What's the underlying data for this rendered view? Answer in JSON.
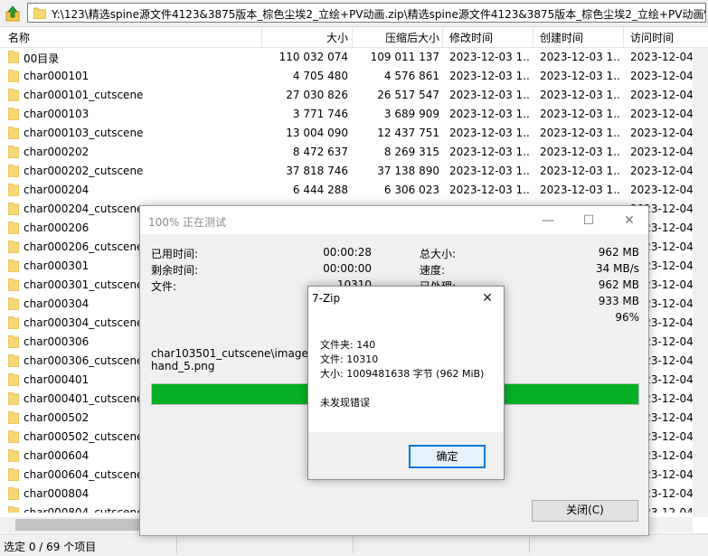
{
  "address_bar": {
    "path": "Y:\\123\\精选spine源文件4123&3875版本_棕色尘埃2_立绘+PV动画.zip\\精选spine源文件4123&3875版本_棕色尘埃2_立绘+PV动画\\"
  },
  "columns": {
    "name": "名称",
    "size": "大小",
    "packed": "压缩后大小",
    "modified": "修改时间",
    "created": "创建时间",
    "accessed": "访问时间"
  },
  "files": [
    {
      "name": "00目录",
      "size": "110 032 074",
      "packed": "109 011 137",
      "modified": "2023-12-03 1...",
      "created": "2023-12-03 1...",
      "accessed": "2023-12-04"
    },
    {
      "name": "char000101",
      "size": "4 705 480",
      "packed": "4 576 861",
      "modified": "2023-12-03 1...",
      "created": "2023-12-03 1...",
      "accessed": "2023-12-04"
    },
    {
      "name": "char000101_cutscene",
      "size": "27 030 826",
      "packed": "26 517 547",
      "modified": "2023-12-03 1...",
      "created": "2023-12-03 1...",
      "accessed": "2023-12-04"
    },
    {
      "name": "char000103",
      "size": "3 771 746",
      "packed": "3 689 909",
      "modified": "2023-12-03 1...",
      "created": "2023-12-03 1...",
      "accessed": "2023-12-04"
    },
    {
      "name": "char000103_cutscene",
      "size": "13 004 090",
      "packed": "12 437 751",
      "modified": "2023-12-03 1...",
      "created": "2023-12-03 1...",
      "accessed": "2023-12-04"
    },
    {
      "name": "char000202",
      "size": "8 472 637",
      "packed": "8 269 315",
      "modified": "2023-12-03 1...",
      "created": "2023-12-03 1...",
      "accessed": "2023-12-04"
    },
    {
      "name": "char000202_cutscene",
      "size": "37 818 746",
      "packed": "37 138 890",
      "modified": "2023-12-03 1...",
      "created": "2023-12-03 1...",
      "accessed": "2023-12-04"
    },
    {
      "name": "char000204",
      "size": "6 444 288",
      "packed": "6 306 023",
      "modified": "2023-12-03 1...",
      "created": "2023-12-03 1...",
      "accessed": "2023-12-04"
    },
    {
      "name": "char000204_cutscene",
      "size": "",
      "packed": "",
      "modified": "",
      "created": "",
      "accessed": "2023-12-04"
    },
    {
      "name": "char000206",
      "size": "",
      "packed": "",
      "modified": "",
      "created": "",
      "accessed": "2023-12-04"
    },
    {
      "name": "char000206_cutscene",
      "size": "",
      "packed": "",
      "modified": "",
      "created": "",
      "accessed": "2023-12-04"
    },
    {
      "name": "char000301",
      "size": "",
      "packed": "",
      "modified": "",
      "created": "",
      "accessed": "2023-12-04"
    },
    {
      "name": "char000301_cutscene",
      "size": "",
      "packed": "",
      "modified": "",
      "created": "",
      "accessed": "2023-12-04"
    },
    {
      "name": "char000304",
      "size": "",
      "packed": "",
      "modified": "",
      "created": "",
      "accessed": "2023-12-04"
    },
    {
      "name": "char000304_cutscene",
      "size": "",
      "packed": "",
      "modified": "",
      "created": "",
      "accessed": "2023-12-04"
    },
    {
      "name": "char000306",
      "size": "",
      "packed": "",
      "modified": "",
      "created": "",
      "accessed": "2023-12-04"
    },
    {
      "name": "char000306_cutscene",
      "size": "",
      "packed": "",
      "modified": "",
      "created": "",
      "accessed": "2023-12-04"
    },
    {
      "name": "char000401",
      "size": "",
      "packed": "",
      "modified": "",
      "created": "",
      "accessed": "2023-12-04"
    },
    {
      "name": "char000401_cutscene",
      "size": "",
      "packed": "",
      "modified": "",
      "created": "",
      "accessed": "2023-12-04"
    },
    {
      "name": "char000502",
      "size": "",
      "packed": "",
      "modified": "",
      "created": "",
      "accessed": "2023-12-04"
    },
    {
      "name": "char000502_cutscene",
      "size": "",
      "packed": "",
      "modified": "",
      "created": "",
      "accessed": "2023-12-04"
    },
    {
      "name": "char000604",
      "size": "",
      "packed": "",
      "modified": "",
      "created": "",
      "accessed": "2023-12-04"
    },
    {
      "name": "char000604_cutscene",
      "size": "",
      "packed": "",
      "modified": "",
      "created": "",
      "accessed": "2023-12-04"
    },
    {
      "name": "char000804",
      "size": "",
      "packed": "",
      "modified": "",
      "created": "",
      "accessed": "2023-12-04"
    },
    {
      "name": "char000804_cutscene",
      "size": "",
      "packed": "",
      "modified": "",
      "created": "",
      "accessed": "2023-12-04"
    }
  ],
  "status": {
    "selection": "选定 0 / 69 个项目"
  },
  "progress_dialog": {
    "title": "100% 正在测试",
    "elapsed_label": "已用时间:",
    "elapsed_value": "00:00:28",
    "remaining_label": "剩余时间:",
    "remaining_value": "00:00:00",
    "files_label": "文件:",
    "files_value": "10310",
    "total_label": "总大小:",
    "total_value": "962 MB",
    "speed_label": "速度:",
    "speed_value": "34 MB/s",
    "processed_label": "已处理:",
    "processed_value": "962 MB",
    "compressed_value": "933 MB",
    "ratio_value": "96%",
    "current_file_line1": "char103501_cutscene\\images\\",
    "current_file_line2": "hand_5.png",
    "progress_fraction": 1.0,
    "close_label": "关闭(C)",
    "accent_color": "#06b025"
  },
  "result_dialog": {
    "title": "7-Zip",
    "folders": "文件夹: 140",
    "files": "文件: 10310",
    "size": "大小: 1009481638 字节 (962 MiB)",
    "message": "未发现错误",
    "ok_label": "确定"
  }
}
